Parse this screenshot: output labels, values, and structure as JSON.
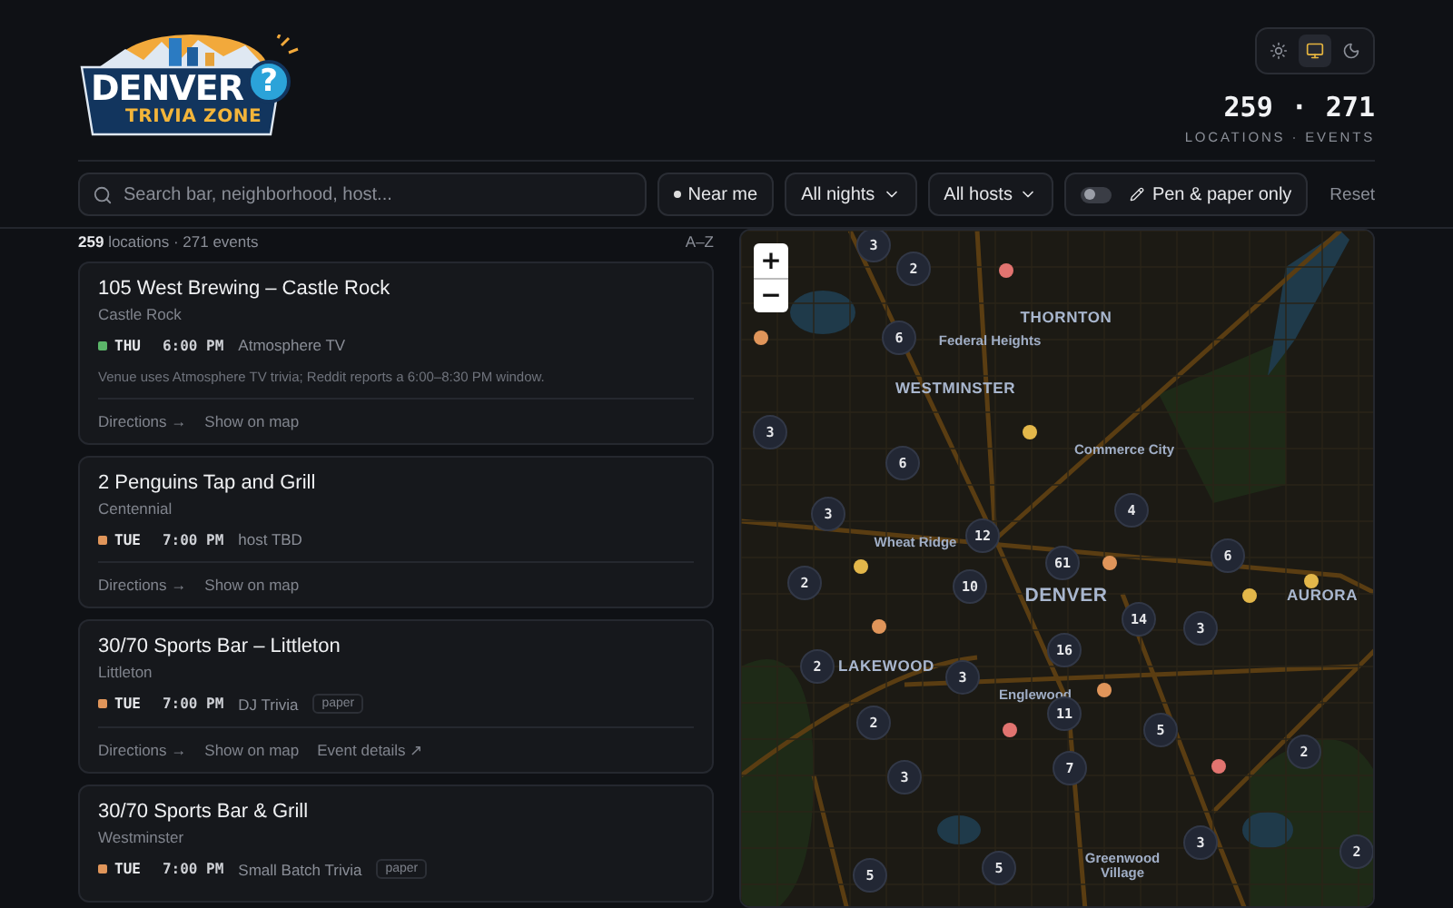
{
  "logo": {
    "word": "DENVER",
    "mark": "?",
    "tagline": "TRIVIA ZONE"
  },
  "theme_switch": [
    {
      "kind": "light",
      "selected": false
    },
    {
      "kind": "system",
      "selected": true
    },
    {
      "kind": "dark",
      "selected": false
    }
  ],
  "stats": {
    "locations": "259",
    "separator": "·",
    "events": "271",
    "caption": "LOCATIONS · EVENTS"
  },
  "filters": {
    "search": {
      "placeholder": "Search bar, neighborhood, host..."
    },
    "near_me": "Near me",
    "nights": "All nights",
    "hosts": "All hosts",
    "pen_paper": {
      "label": "Pen & paper only",
      "on": false
    },
    "reset": "Reset"
  },
  "summary": {
    "count": "259",
    "text": "locations · 271 events",
    "sort": "A–Z"
  },
  "venues": [
    {
      "name": "105 West Brewing – Castle Rock",
      "area": "Castle Rock",
      "day": "THU",
      "time": "6:00 PM",
      "host": "Atmosphere TV",
      "color": "#5bb569",
      "note": "Venue uses Atmosphere TV trivia; Reddit reports a 6:00–8:30 PM window.",
      "links": [
        "Directions →",
        "Show on map"
      ]
    },
    {
      "name": "2 Penguins Tap and Grill",
      "area": "Centennial",
      "day": "TUE",
      "time": "7:00 PM",
      "host": "host TBD",
      "color": "#e0955a",
      "links": [
        "Directions →",
        "Show on map"
      ]
    },
    {
      "name": "30/70 Sports Bar – Littleton",
      "area": "Littleton",
      "day": "TUE",
      "time": "7:00 PM",
      "host": "DJ Trivia",
      "tag": "paper",
      "color": "#e0955a",
      "links": [
        "Directions →",
        "Show on map",
        "Event details ↗"
      ]
    },
    {
      "name": "30/70 Sports Bar & Grill",
      "area": "Westminster",
      "day": "TUE",
      "time": "7:00 PM",
      "host": "Small Batch Trivia",
      "tag": "paper",
      "color": "#e0955a"
    }
  ],
  "map": {
    "zoom_in": "+",
    "zoom_out": "−",
    "places": [
      {
        "name": "THORNTON",
        "kind": "city"
      },
      {
        "name": "Federal Heights",
        "kind": "town"
      },
      {
        "name": "WESTMINSTER",
        "kind": "city"
      },
      {
        "name": "Commerce City",
        "kind": "town"
      },
      {
        "name": "Wheat Ridge",
        "kind": "town"
      },
      {
        "name": "DENVER",
        "kind": "capital"
      },
      {
        "name": "AURORA",
        "kind": "city"
      },
      {
        "name": "LAKEWOOD",
        "kind": "city"
      },
      {
        "name": "Englewood",
        "kind": "town"
      },
      {
        "name": "Greenwood Village",
        "kind": "town"
      }
    ],
    "clusters": [
      "3",
      "2",
      "6",
      "3",
      "6",
      "3",
      "12",
      "61",
      "4",
      "6",
      "2",
      "10",
      "14",
      "3",
      "16",
      "2",
      "3",
      "11",
      "5",
      "2",
      "7",
      "2",
      "3",
      "3",
      "2",
      "5",
      "5"
    ],
    "pins": [
      {
        "color": "#e27470"
      },
      {
        "color": "#e0955a"
      },
      {
        "color": "#e3b74a"
      },
      {
        "color": "#e3b74a"
      },
      {
        "color": "#e0955a"
      },
      {
        "color": "#e3b74a"
      },
      {
        "color": "#e3b74a"
      },
      {
        "color": "#e0955a"
      },
      {
        "color": "#e0955a"
      },
      {
        "color": "#e27470"
      },
      {
        "color": "#e27470"
      }
    ]
  }
}
